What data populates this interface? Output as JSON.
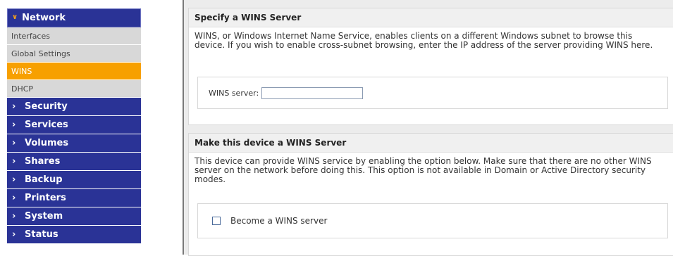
{
  "sidebar": {
    "header": {
      "label": "Network",
      "icon": "chevron-down-icon"
    },
    "sub_items": [
      {
        "label": "Interfaces",
        "active": false
      },
      {
        "label": "Global Settings",
        "active": false
      },
      {
        "label": "WINS",
        "active": true
      },
      {
        "label": "DHCP",
        "active": false
      }
    ],
    "items": [
      {
        "label": "Security"
      },
      {
        "label": "Services"
      },
      {
        "label": "Volumes"
      },
      {
        "label": "Shares"
      },
      {
        "label": "Backup"
      },
      {
        "label": "Printers"
      },
      {
        "label": "System"
      },
      {
        "label": "Status"
      }
    ]
  },
  "wins_server_section": {
    "title": "Specify a WINS Server",
    "description": "WINS, or Windows Internet Name Service, enables clients on a different Windows subnet to browse this device. If you wish to enable cross-subnet browsing, enter the IP address of the server providing WINS here.",
    "field_label": "WINS server:",
    "field_value": ""
  },
  "become_wins_section": {
    "title": "Make this device a WINS Server",
    "description": "This device can provide WINS service by enabling the option below. Make sure that there are no other WINS server on the network before doing this. This option is not available in Domain or Active Directory security modes.",
    "checkbox_label": "Become a WINS server",
    "checked": false
  },
  "colors": {
    "nav_blue": "#2a3396",
    "active_orange": "#f7a000",
    "sub_gray": "#d8d8d8"
  }
}
